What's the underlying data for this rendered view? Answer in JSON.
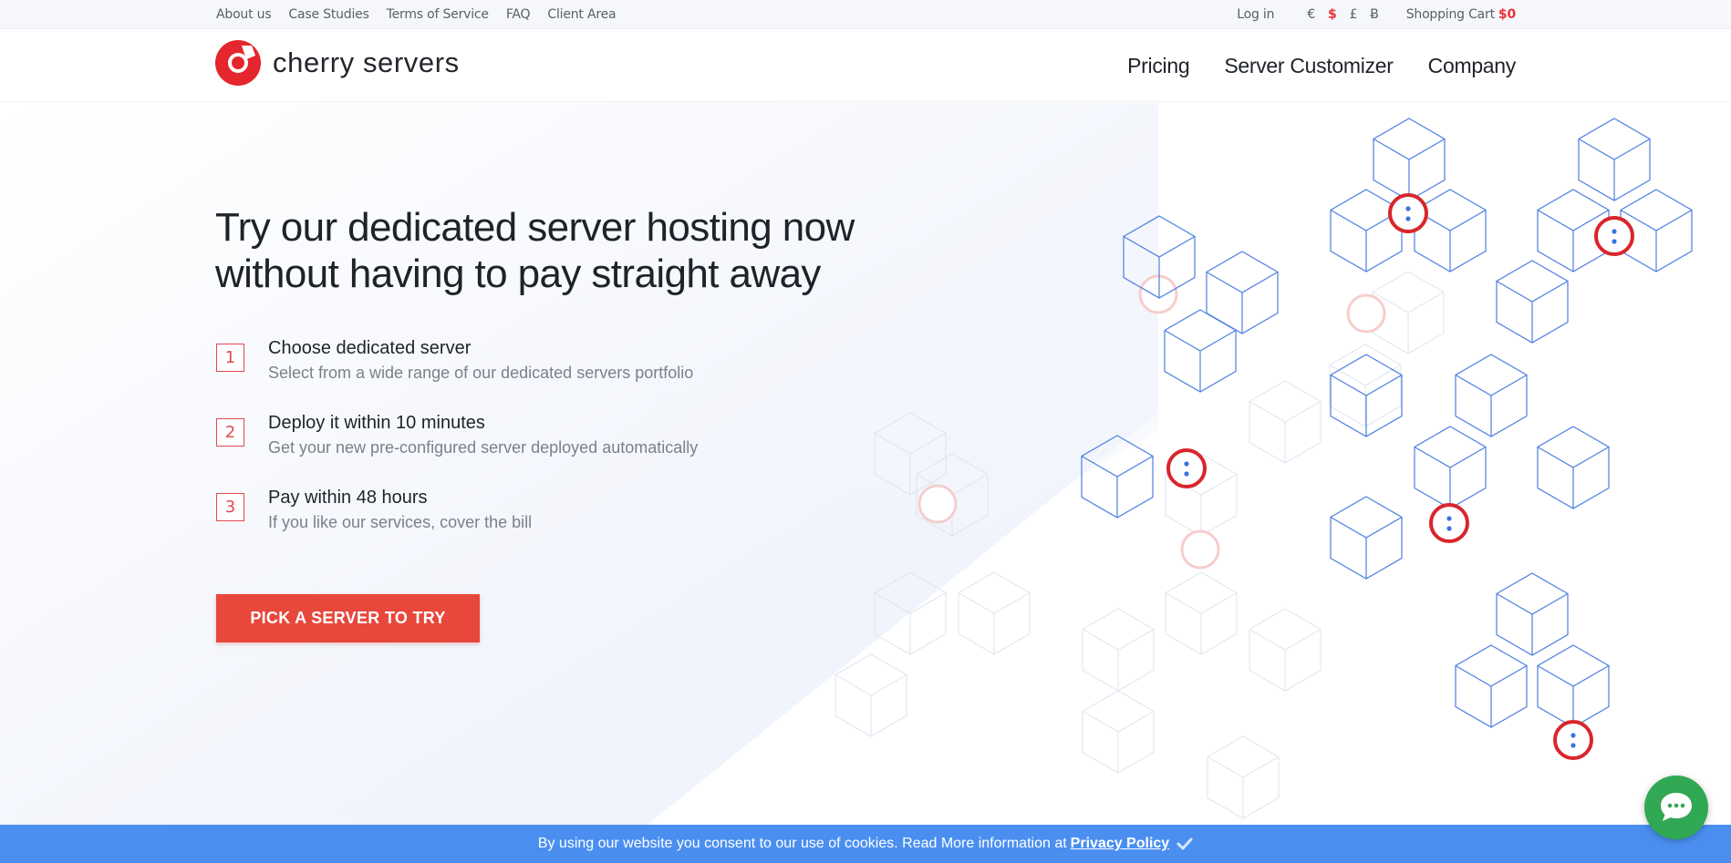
{
  "topbar": {
    "links": [
      "About us",
      "Case Studies",
      "Terms of Service",
      "FAQ",
      "Client Area"
    ],
    "login": "Log in",
    "currencies": [
      "€",
      "$",
      "£",
      "Ƀ"
    ],
    "selected_currency": "$",
    "cart_label": "Shopping Cart",
    "cart_amount": "$0"
  },
  "header": {
    "logo_text": "cherry servers",
    "nav": [
      "Pricing",
      "Server Customizer",
      "Company"
    ]
  },
  "hero": {
    "title_line1": "Try our dedicated server hosting now",
    "title_line2": "without having to pay straight away",
    "steps": [
      {
        "num": "1",
        "title": "Choose dedicated server",
        "desc": "Select from a wide range of our dedicated servers portfolio"
      },
      {
        "num": "2",
        "title": "Deploy it within 10 minutes",
        "desc": "Get your new pre-configured server deployed automatically"
      },
      {
        "num": "3",
        "title": "Pay within 48 hours",
        "desc": "If you like our services, cover the bill"
      }
    ],
    "cta_label": "PICK A SERVER TO TRY"
  },
  "cookie": {
    "text": "By using our website you consent to our use of cookies. Read More information at",
    "link": "Privacy Policy"
  },
  "colors": {
    "brand_red": "#e6323a",
    "cta_red": "#e8473c",
    "cookie_blue": "#4a8ff0",
    "chat_green": "#31a853"
  },
  "icons": {
    "logo": "cherry-logo-icon",
    "chat": "chat-bubble-icon",
    "cookie_accept": "checkmark-icon"
  }
}
